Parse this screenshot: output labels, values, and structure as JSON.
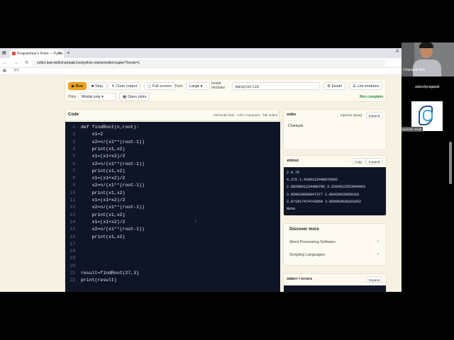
{
  "browser": {
    "tab_title": "Programmer's Point — Pytho",
    "new_tab": "+",
    "url": "editor.learnwithchampak.live/python-starter/editor/super/?mode=1",
    "nav_icons": "← → ↻ ⌂",
    "bookmark_folder": "PY",
    "tabbar_right": "A"
  },
  "toolbar": {
    "run": "▶ Run",
    "stop": "■ Stop",
    "clear": "✕ Clear output",
    "fullscreen": "▢ Full screen",
    "font_label": "Font",
    "font_value": "Large ▾",
    "install_label_1": "Install",
    "install_label_2": "modules",
    "module_input": "matplotlib",
    "install_button": "⚙ Install",
    "list_modules": "☰ List modules",
    "plots_label": "Plots",
    "plots_value": "Modal only ▾",
    "open_plots": "▦ Open plots",
    "status": "Run complete"
  },
  "code": {
    "title": "Code",
    "hint": "Ctrl+Enter Run · Ctrl+/ Comment · Tab Indent",
    "lines": [
      "def findRoot(n,root):",
      "    x1=2",
      "    x2=n/(x1**(root-1))",
      "    print(x1,x2)",
      "    x1=(x1+x2)/2",
      "    x2=n/(x1**(root-1))",
      "    print(x1,x2)",
      "    x1=(x1+x2)/2",
      "    x2=n/(x1**(root-1))",
      "    print(x1,x2)",
      "    x1=(x1+x2)/2",
      "    x2=n/(x1**(root-1))",
      "    print(x1,x2)",
      "    x1=(x1+x2)/2",
      "    x2=n/(x1**(root-1))",
      "    print(x1,x2)",
      "",
      "",
      "",
      "",
      "result=findRoot(27,3)",
      "print(result)"
    ],
    "cursor": "I"
  },
  "stdin": {
    "title": "stdin",
    "input_hint": "Input for input()",
    "expand": "Expand",
    "value": "Champak"
  },
  "stdout": {
    "title": "stdout",
    "copy": "Copy",
    "expand": "Expand",
    "lines": [
      "2 6.75",
      "4.375 1.4106122448979592",
      "2.8928061224489796 3.2264512553604963",
      "3.059628688047377 2.88420626050318",
      "2.971917474743959 3.056963638183262",
      "None"
    ]
  },
  "discover": {
    "title": "Discover more",
    "items": [
      "Word Processing Software",
      "Scripting Languages"
    ],
    "chevron": "›"
  },
  "stderr": {
    "title": "stderr / errors",
    "expand": "Expand"
  },
  "meeting": {
    "presenter_name": "Champak Roy",
    "participant_1": "adarshprajapati",
    "participant_2": "avinash singh"
  }
}
